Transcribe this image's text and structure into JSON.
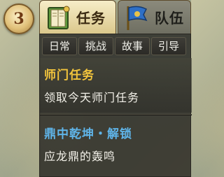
{
  "fold_button": {
    "glyph": "3",
    "icon": "spiral-arrow-icon"
  },
  "tabs": [
    {
      "label": "任务",
      "icon": "quest-book-icon",
      "active": true
    },
    {
      "label": "队伍",
      "icon": "team-flag-icon",
      "active": false
    }
  ],
  "subtabs": [
    {
      "label": "日常"
    },
    {
      "label": "挑战"
    },
    {
      "label": "故事"
    },
    {
      "label": "引导"
    }
  ],
  "quests": [
    {
      "title": "师门任务",
      "desc": "领取今天师门任务",
      "title_color": "#f2c43c"
    },
    {
      "title": "鼎中乾坤・解锁",
      "desc": "应龙鼎的轰鸣",
      "title_color": "#5fb4e8"
    }
  ]
}
